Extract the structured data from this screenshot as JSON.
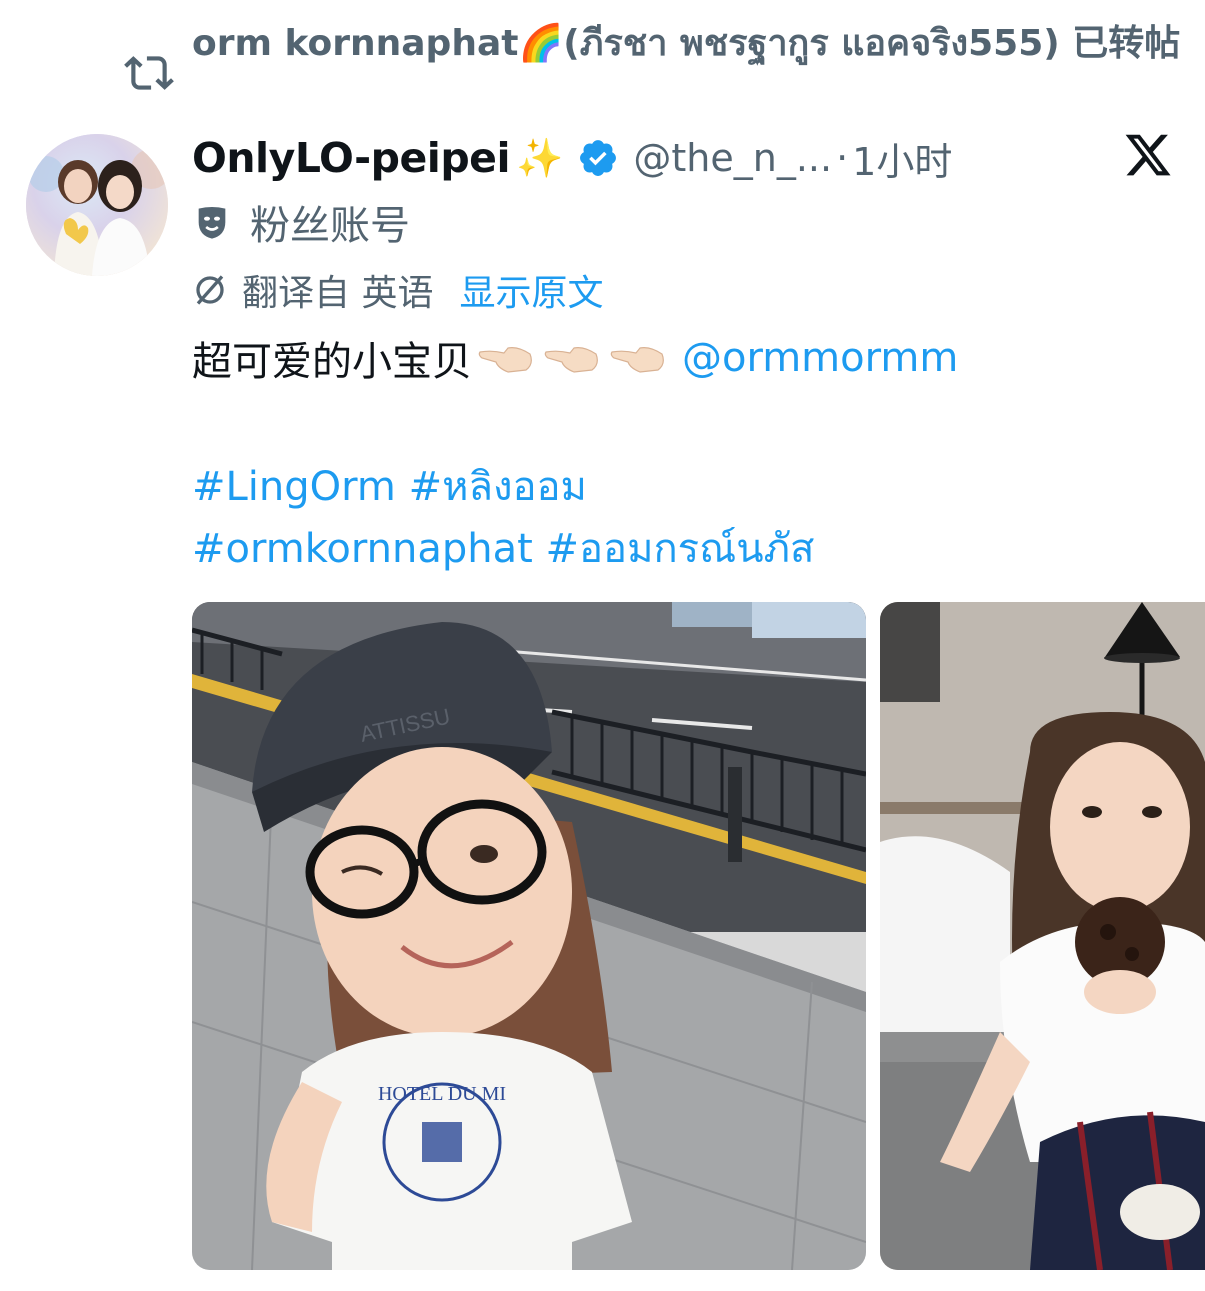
{
  "repost": {
    "icon": "repost-icon",
    "text": "orm kornnaphat🌈(ภีรชา พชรฐากูร แอคจริง555) 已转帖"
  },
  "author": {
    "display_name": "OnlyLO-peipei",
    "name_emoji": "✨",
    "verified": true,
    "handle": "@the_n_...",
    "separator": "·",
    "time": "1小时",
    "fan_icon": "theater-mask-icon",
    "fan_label": "粉丝账号"
  },
  "brand": {
    "icon": "x-logo-icon"
  },
  "translation": {
    "icon": "translate-icon",
    "label": "翻译自 英语",
    "show_original": "显示原文"
  },
  "tweet": {
    "text": "超可爱的小宝贝",
    "emoji_name": "pointing-left-hand-emoji",
    "emoji_count": 3,
    "mention": "@ormmormm",
    "hashtags_line1": "#LingOrm #หลิงออม",
    "hashtags_line2": "#ormkornnaphat #ออมกรณ์นภัส"
  },
  "media": {
    "photo1": {
      "shirt_text": "HOTEL DU MI",
      "cap_text": "ATTISSU"
    },
    "photo2": {}
  },
  "colors": {
    "link": "#1d9bf0",
    "secondary": "#536471",
    "primary": "#0f1419",
    "verified": "#1d9bf0"
  }
}
